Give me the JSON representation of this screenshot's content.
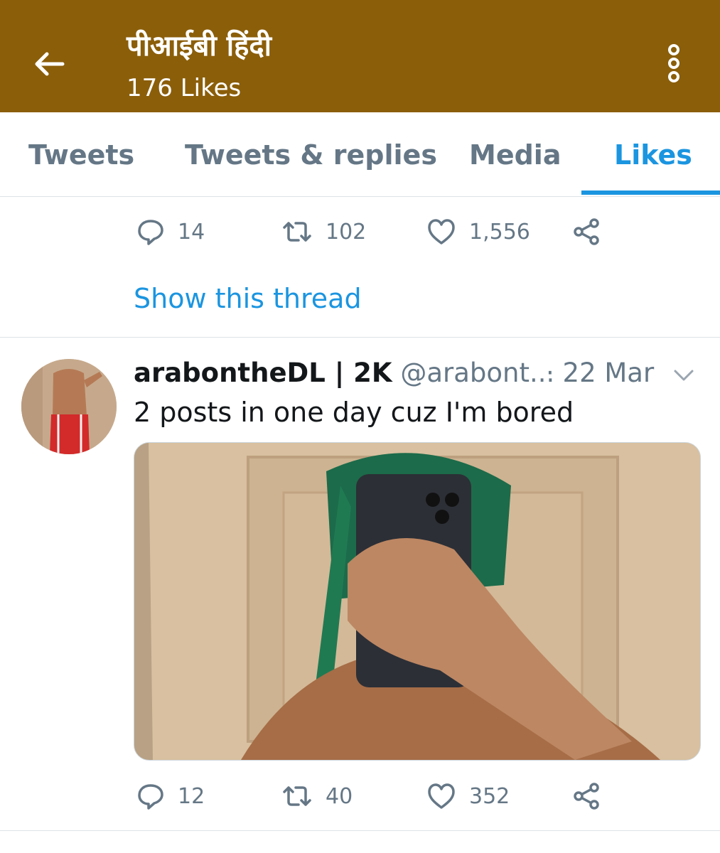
{
  "header": {
    "title": "पीआईबी हिंदी",
    "subtitle": "176 Likes",
    "back_icon": "arrow-left-icon",
    "more_icon": "more-vertical-icon",
    "bg_color": "#8b5e0a"
  },
  "tabs": [
    {
      "label": "Tweets",
      "active": false
    },
    {
      "label": "Tweets & replies",
      "active": false
    },
    {
      "label": "Media",
      "active": false
    },
    {
      "label": "Likes",
      "active": true
    }
  ],
  "accent_color": "#1b95e0",
  "prev_tweet": {
    "replies": "14",
    "retweets": "102",
    "likes": "1,556",
    "show_thread": "Show this thread"
  },
  "tweet": {
    "name": "arabontheDL | 2K",
    "handle": "@arabont...",
    "date": "· 22 Mar",
    "text": "2 posts in one day cuz I'm bored",
    "replies": "12",
    "retweets": "40",
    "likes": "352"
  }
}
